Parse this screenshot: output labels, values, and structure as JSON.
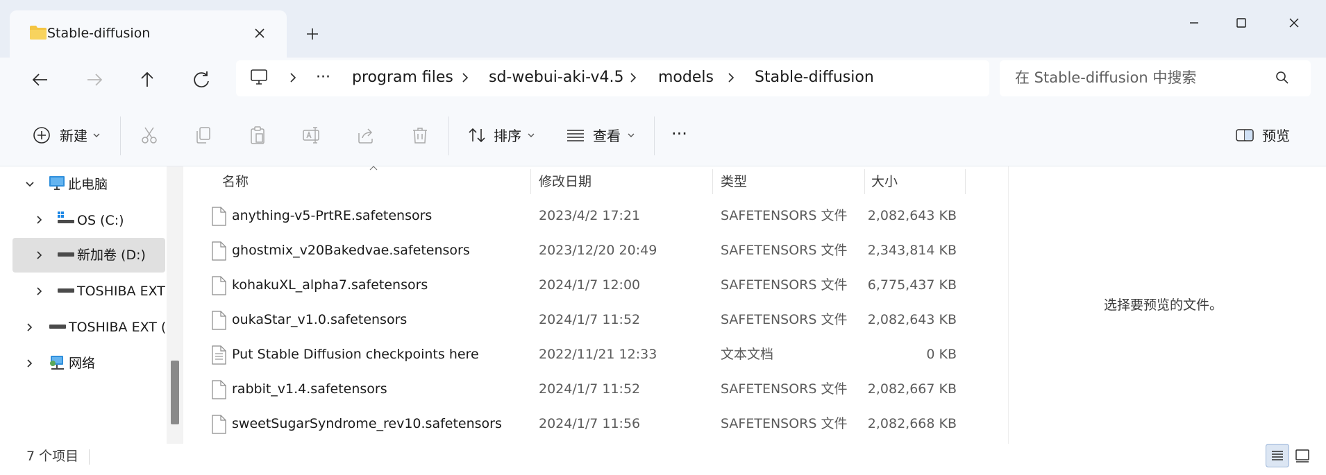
{
  "tab": {
    "title": "Stable-diffusion",
    "folder_icon": "folder-icon",
    "close_icon": "close-icon",
    "new_tab_icon": "plus-icon"
  },
  "window_controls": [
    "minimize-icon",
    "maximize-icon",
    "close-icon"
  ],
  "address_bar": {
    "crumbs": [
      "program files",
      "sd-webui-aki-v4.5",
      "models",
      "Stable-diffusion"
    ],
    "overflow": "···",
    "root_icon": "computer-icon"
  },
  "search": {
    "placeholder": "在 Stable-diffusion 中搜索",
    "icon": "search-icon"
  },
  "toolbar": {
    "new_label": "新建",
    "sort_label": "排序",
    "view_label": "查看",
    "more_label": "···",
    "preview_label": "预览"
  },
  "nav": {
    "items": [
      {
        "label": "此电脑",
        "icon": "computer-icon",
        "expanded": true
      },
      {
        "label": "OS (C:)",
        "icon": "windows-drive-icon"
      },
      {
        "label": "新加卷 (D:)",
        "icon": "drive-icon",
        "selected": true
      },
      {
        "label": "TOSHIBA EXT",
        "icon": "drive-icon"
      },
      {
        "label": "TOSHIBA EXT (I",
        "icon": "drive-icon"
      },
      {
        "label": "网络",
        "icon": "network-icon"
      }
    ]
  },
  "columns": {
    "name": "名称",
    "date": "修改日期",
    "type": "类型",
    "size": "大小"
  },
  "files": [
    {
      "name": "anything-v5-PrtRE.safetensors",
      "date": "2023/4/2 17:21",
      "type": "SAFETENSORS 文件",
      "size": "2,082,643 KB",
      "icon": "file-icon"
    },
    {
      "name": "ghostmix_v20Bakedvae.safetensors",
      "date": "2023/12/20 20:49",
      "type": "SAFETENSORS 文件",
      "size": "2,343,814 KB",
      "icon": "file-icon"
    },
    {
      "name": "kohakuXL_alpha7.safetensors",
      "date": "2024/1/7 12:00",
      "type": "SAFETENSORS 文件",
      "size": "6,775,437 KB",
      "icon": "file-icon"
    },
    {
      "name": "oukaStar_v1.0.safetensors",
      "date": "2024/1/7 11:52",
      "type": "SAFETENSORS 文件",
      "size": "2,082,643 KB",
      "icon": "file-icon"
    },
    {
      "name": "Put Stable Diffusion checkpoints here",
      "date": "2022/11/21 12:33",
      "type": "文本文档",
      "size": "0 KB",
      "icon": "text-file-icon"
    },
    {
      "name": "rabbit_v1.4.safetensors",
      "date": "2024/1/7 11:52",
      "type": "SAFETENSORS 文件",
      "size": "2,082,667 KB",
      "icon": "file-icon"
    },
    {
      "name": "sweetSugarSyndrome_rev10.safetensors",
      "date": "2024/1/7 11:56",
      "type": "SAFETENSORS 文件",
      "size": "2,082,668 KB",
      "icon": "file-icon"
    }
  ],
  "preview": {
    "message": "选择要预览的文件。"
  },
  "status": {
    "count": "7 个项目"
  }
}
